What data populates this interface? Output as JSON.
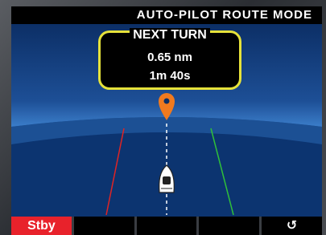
{
  "header": {
    "title": "AUTO-PILOT ROUTE MODE"
  },
  "next_turn": {
    "title": "NEXT TURN",
    "distance": "0.65 nm",
    "time": "1m 40s"
  },
  "softkeys": [
    {
      "label": "Stby"
    },
    {
      "label": ""
    },
    {
      "label": ""
    },
    {
      "label": ""
    },
    {
      "label": "↺"
    }
  ],
  "colors": {
    "accent_yellow": "#e6e23a",
    "standby_red": "#e8222b",
    "waypoint_orange": "#f07a1f",
    "port_line": "#e02424",
    "starboard_line": "#2fbf3a"
  }
}
